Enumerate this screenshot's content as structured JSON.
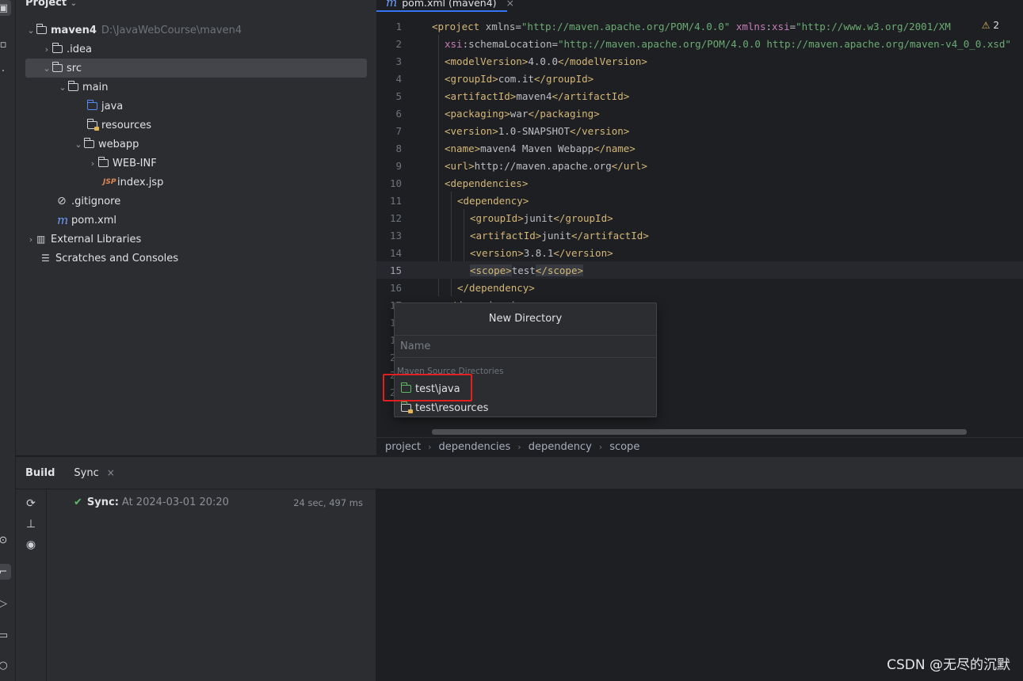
{
  "project_panel": {
    "title": "Project",
    "tree": [
      {
        "label": "maven4",
        "hint": "D:\\JavaWebCourse\\maven4"
      },
      {
        "label": ".idea"
      },
      {
        "label": "src"
      },
      {
        "label": "main"
      },
      {
        "label": "java"
      },
      {
        "label": "resources"
      },
      {
        "label": "webapp"
      },
      {
        "label": "WEB-INF"
      },
      {
        "label": "index.jsp",
        "icon_text": "JSP"
      },
      {
        "label": ".gitignore"
      },
      {
        "label": "pom.xml",
        "icon_text": "m"
      },
      {
        "label": "External Libraries"
      },
      {
        "label": "Scratches and Consoles"
      }
    ]
  },
  "editor": {
    "tab": {
      "icon_text": "m",
      "label": "pom.xml (maven4)",
      "close": "×"
    },
    "inspection_count": "2",
    "line_numbers": [
      "1",
      "2",
      "3",
      "4",
      "5",
      "6",
      "7",
      "8",
      "9",
      "10",
      "11",
      "12",
      "13",
      "14",
      "15",
      "16",
      "17",
      "18",
      "19",
      "20",
      "21",
      "22"
    ],
    "current_line": "15",
    "lines": [
      {
        "tag_open": "<project ",
        "attr1": "xmlns",
        "eq1": "=",
        "val1": "\"http://maven.apache.org/POM/4.0.0\" ",
        "ns2": "xmlns",
        "colon2": ":",
        "attr2": "xsi",
        "eq2": "=",
        "val2": "\"http://www.w3.org/2001/XM"
      },
      {
        "ns": "xsi",
        "colon": ":",
        "attr": "schemaLocation",
        "eq": "=",
        "val": "\"http://maven.apache.org/POM/4.0.0 http://maven.apache.org/maven-v4_0_0.xsd\""
      },
      {
        "open": "<modelVersion>",
        "text": "4.0.0",
        "close": "</modelVersion>"
      },
      {
        "open": "<groupId>",
        "text": "com.it",
        "close": "</groupId>"
      },
      {
        "open": "<artifactId>",
        "text": "maven4",
        "close": "</artifactId>"
      },
      {
        "open": "<packaging>",
        "text": "war",
        "close": "</packaging>"
      },
      {
        "open": "<version>",
        "text": "1.0-SNAPSHOT",
        "close": "</version>"
      },
      {
        "open": "<name>",
        "text": "maven4 Maven Webapp",
        "close": "</name>"
      },
      {
        "open": "<url>",
        "text": "http://maven.apache.org",
        "close": "</url>"
      },
      {
        "open": "<dependencies>"
      },
      {
        "open": "<dependency>"
      },
      {
        "open": "<groupId>",
        "text": "junit",
        "close": "</groupId>"
      },
      {
        "open": "<artifactId>",
        "text": "junit",
        "close": "</artifactId>"
      },
      {
        "open": "<version>",
        "text": "3.8.1",
        "close": "</version>"
      },
      {
        "open": "<scope>",
        "text": "test",
        "close": "</scope>"
      },
      {
        "open": "</dependency>"
      },
      {
        "open": "</dependencies>"
      }
    ]
  },
  "breadcrumb": [
    "project",
    "dependencies",
    "dependency",
    "scope"
  ],
  "new_directory_popup": {
    "title": "New Directory",
    "name_placeholder": "Name",
    "section_label": "Maven Source Directories",
    "items": [
      "test\\java",
      "test\\resources"
    ]
  },
  "build_panel": {
    "tabs": [
      {
        "label": "Build"
      },
      {
        "label": "Sync",
        "close": "×"
      }
    ],
    "sync": {
      "check": "✔",
      "label": "Sync:",
      "at": "At 2024-03-01 20:20",
      "duration": "24 sec, 497 ms"
    }
  },
  "watermark": "CSDN @无尽的沉默",
  "colors": {
    "accent": "#3574f0",
    "highlight_box": "#e02020",
    "tag": "#d5b778",
    "string": "#6aab73"
  }
}
